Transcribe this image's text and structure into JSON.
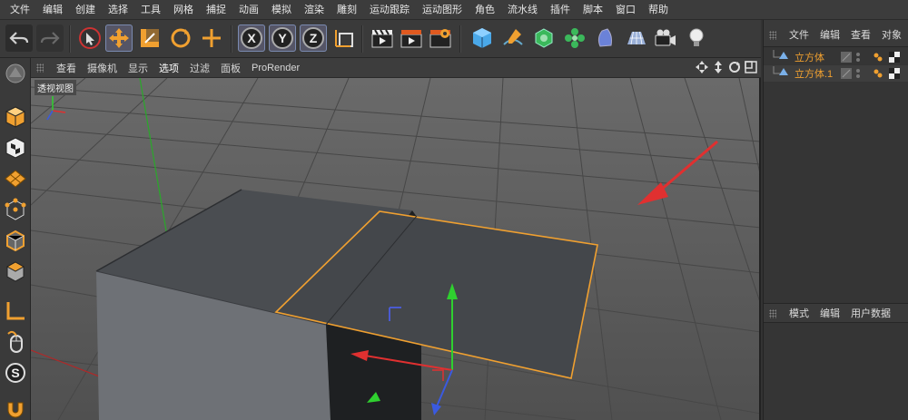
{
  "menu": [
    "文件",
    "编辑",
    "创建",
    "选择",
    "工具",
    "网格",
    "捕捉",
    "动画",
    "模拟",
    "渲染",
    "雕刻",
    "运动跟踪",
    "运动图形",
    "角色",
    "流水线",
    "插件",
    "脚本",
    "窗口",
    "帮助"
  ],
  "viewport": {
    "menu": [
      "查看",
      "摄像机",
      "显示",
      "选项",
      "过滤",
      "面板",
      "ProRender"
    ],
    "active_menu": "选项",
    "label": "透视视图"
  },
  "object_manager": {
    "menu": [
      "文件",
      "编辑",
      "查看",
      "对象"
    ],
    "objects": [
      {
        "name": "立方体"
      },
      {
        "name": "立方体.1"
      }
    ]
  },
  "attribute_manager": {
    "menu": [
      "模式",
      "编辑",
      "用户数据"
    ]
  },
  "toolbar": {
    "axis_labels": [
      "X",
      "Y",
      "Z"
    ]
  },
  "colors": {
    "accent_orange": "#f0a030",
    "selection_blue": "#6a8ad0",
    "annotation_red": "#e03030"
  }
}
